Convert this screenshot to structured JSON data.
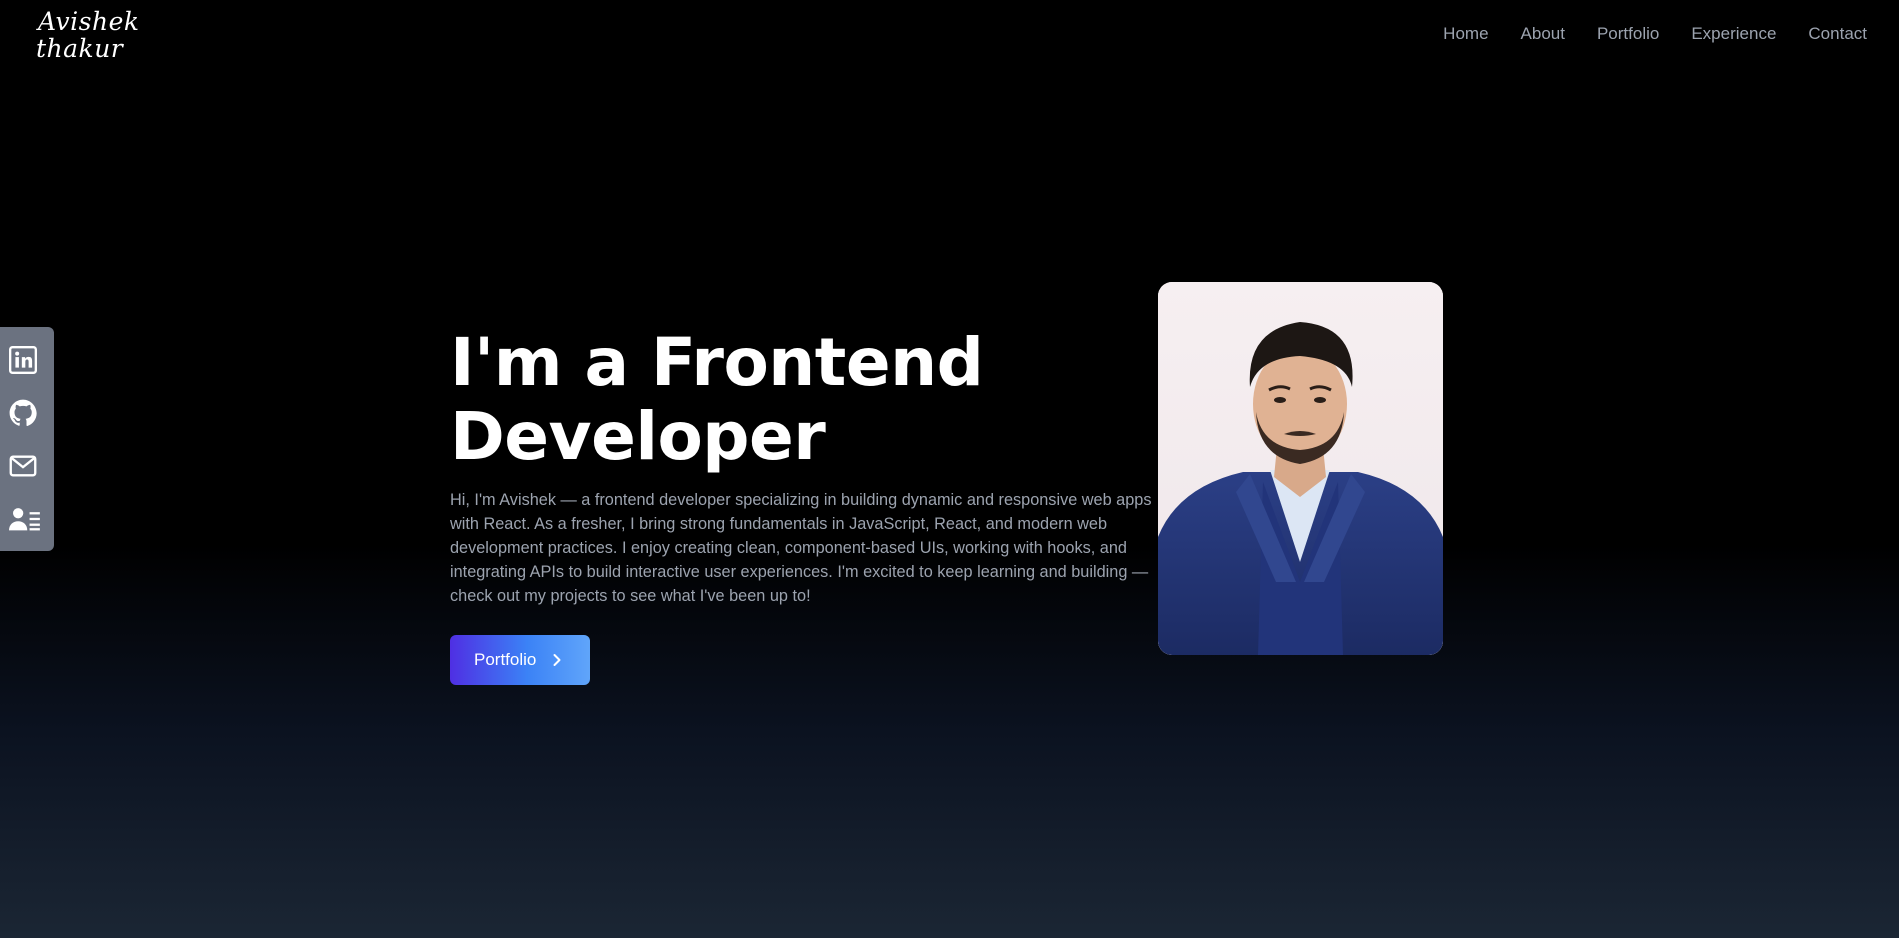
{
  "header": {
    "logo_line1": "Avishek",
    "logo_line2": "thakur",
    "nav": [
      "Home",
      "About",
      "Portfolio",
      "Experience",
      "Contact"
    ]
  },
  "social": {
    "icons": [
      "linkedin-icon",
      "github-icon",
      "mail-icon",
      "resume-icon"
    ]
  },
  "hero": {
    "title_line1": "I'm a Frontend",
    "title_line2": "Developer",
    "description": "Hi, I'm Avishek — a frontend developer specializing in building dynamic and responsive web apps with React. As a fresher, I bring strong fundamentals in JavaScript, React, and modern web development practices. I enjoy creating clean, component-based UIs, working with hooks, and integrating APIs to build interactive user experiences. I'm excited to keep learning and building — check out my projects to see what I've been up to!",
    "cta_label": "Portfolio"
  },
  "colors": {
    "accent_start": "#4f2fe3",
    "accent_end": "#60a5fa",
    "nav_text": "#9ca3af",
    "sidebar_bg": "#6b7280"
  }
}
